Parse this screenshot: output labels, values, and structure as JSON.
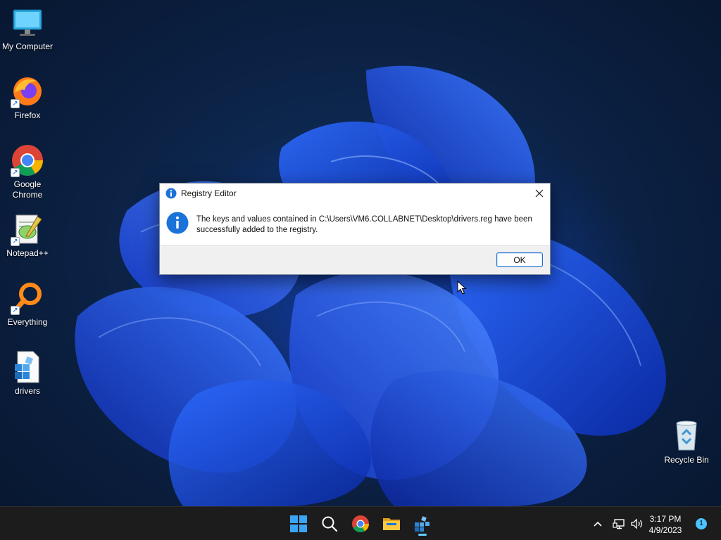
{
  "desktop": {
    "icons": [
      {
        "label": "My Computer",
        "icon": "monitor-icon",
        "shortcut": false
      },
      {
        "label": "Firefox",
        "icon": "firefox-icon",
        "shortcut": true
      },
      {
        "label": "Google Chrome",
        "icon": "chrome-icon",
        "shortcut": true
      },
      {
        "label": "Notepad++",
        "icon": "notepadpp-icon",
        "shortcut": true
      },
      {
        "label": "Everything",
        "icon": "everything-search-icon",
        "shortcut": true
      },
      {
        "label": "drivers",
        "icon": "registry-file-icon",
        "shortcut": false
      },
      {
        "label": "Recycle Bin",
        "icon": "recycle-bin-icon",
        "shortcut": false
      }
    ]
  },
  "dialog": {
    "title": "Registry Editor",
    "message": "The keys and values contained in C:\\Users\\VM6.COLLABNET\\Desktop\\drivers.reg have been successfully added to the registry.",
    "ok_label": "OK",
    "icon": "info-icon"
  },
  "taskbar": {
    "apps": [
      "start-icon",
      "search-icon",
      "chrome-icon",
      "file-explorer-icon",
      "registry-editor-icon"
    ],
    "active_app": "registry-editor-icon",
    "time": "3:17 PM",
    "date": "4/9/2023",
    "notification_count": "1"
  },
  "colors": {
    "accent": "#1f6fd2",
    "info_blue": "#1a73d9",
    "taskbar": "#1c1c1c"
  }
}
